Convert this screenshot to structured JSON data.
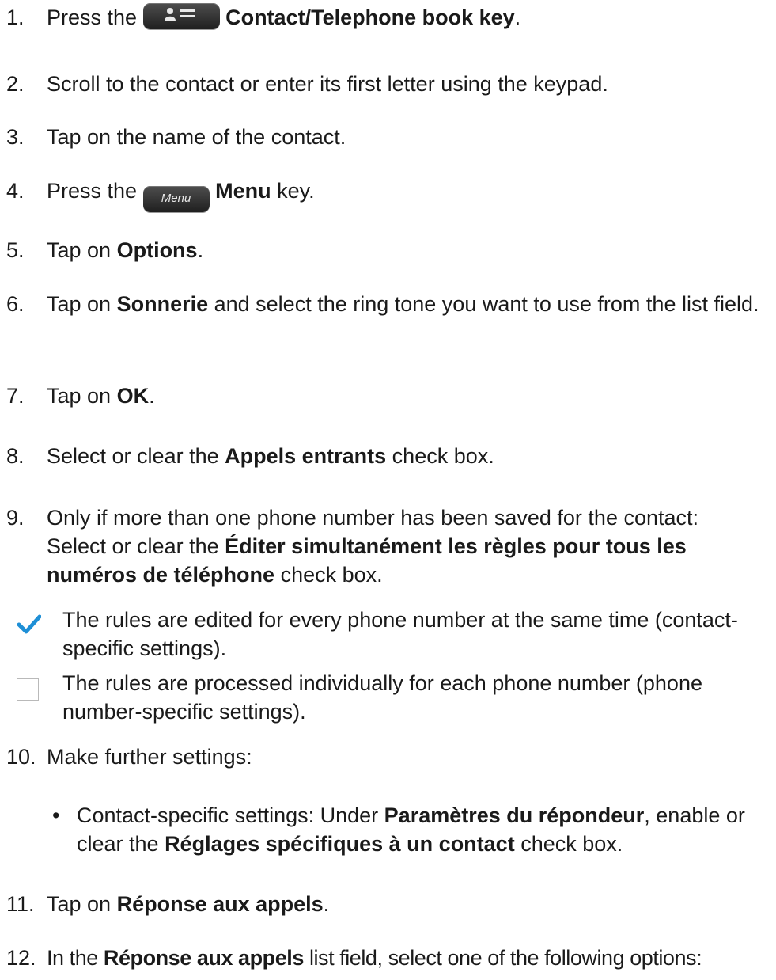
{
  "steps": [
    {
      "num": "1.",
      "pre": "Press the ",
      "key": "Contact/Telephone book key",
      "post": "."
    },
    {
      "num": "2.",
      "text": "Scroll to the contact or enter its first letter using the keypad."
    },
    {
      "num": "3.",
      "text": "Tap on the name of the contact."
    },
    {
      "num": "4.",
      "pre": "Press the ",
      "key_label": "Menu",
      "key": "Menu",
      "post": " key."
    },
    {
      "num": "5.",
      "pre": "Tap on ",
      "bold": "Options",
      "post": "."
    },
    {
      "num": "6.",
      "pre": "Tap on ",
      "bold": "Sonnerie",
      "post": " and select the ring tone you want to use from the list field."
    },
    {
      "num": "7.",
      "pre": "Tap on ",
      "bold": "OK",
      "post": "."
    },
    {
      "num": "8.",
      "pre": "Select or clear the ",
      "bold": "Appels entrants",
      "post": " check box."
    },
    {
      "num": "9.",
      "pre": "Only if more than one phone number has been saved for the contact: Select or clear the ",
      "bold": "Éditer simultanément les règles pour tous les numéros de téléphone",
      "post": " check box."
    },
    {
      "num": "10.",
      "text": "Make further settings:"
    },
    {
      "num": "11.",
      "pre": "Tap on ",
      "bold": "Réponse aux appels",
      "post": "."
    },
    {
      "num": "12.",
      "pre": "In the ",
      "bold": "Réponse aux appels",
      "post": " list field, select one of the following options:"
    }
  ],
  "checkbox_options": [
    {
      "checked": true,
      "text": "The rules are edited for every phone number at the same time (contact-specific settings)."
    },
    {
      "checked": false,
      "text": "The rules are processed individually for each phone number (phone number-specific settings)."
    }
  ],
  "sub_bullet": {
    "bullet": "•",
    "pre": "Contact-specific settings: Under ",
    "bold1": "Paramètres du répondeur",
    "mid": ", enable or clear the ",
    "bold2": "Réglages spécifiques à un contact",
    "post": " check box."
  },
  "colors": {
    "text": "#1a1a1a",
    "check": "#1e8fd6",
    "key": "#2f2f2f"
  },
  "icons": {
    "contact_key": "contact-book-key-icon",
    "check": "checkmark-icon"
  }
}
